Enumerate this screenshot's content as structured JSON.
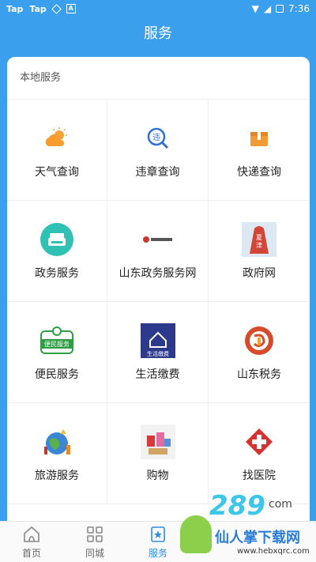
{
  "status": {
    "left_icons": [
      "Tap",
      "Tap"
    ],
    "time": "7:36"
  },
  "app_bar": {
    "title": "服务"
  },
  "section": {
    "title": "本地服务"
  },
  "services": [
    {
      "label": "天气查询",
      "icon": "weather-icon"
    },
    {
      "label": "违章查询",
      "icon": "traffic-violation-icon"
    },
    {
      "label": "快递查询",
      "icon": "package-icon"
    },
    {
      "label": "政务服务",
      "icon": "government-service-icon"
    },
    {
      "label": "山东政务服务网",
      "icon": "shandong-gov-logo"
    },
    {
      "label": "政府网",
      "icon": "government-site-icon"
    },
    {
      "label": "便民服务",
      "icon": "convenience-icon",
      "icon_text": "便民服务"
    },
    {
      "label": "生活缴费",
      "icon": "life-payment-icon",
      "icon_text": "生活缴费"
    },
    {
      "label": "山东税务",
      "icon": "tax-icon"
    },
    {
      "label": "旅游服务",
      "icon": "tourism-icon"
    },
    {
      "label": "购物",
      "icon": "shopping-icon"
    },
    {
      "label": "找医院",
      "icon": "hospital-icon"
    }
  ],
  "bottom_nav": [
    {
      "label": "首页",
      "icon": "home-icon"
    },
    {
      "label": "同城",
      "icon": "grid-icon"
    },
    {
      "label": "服务",
      "icon": "service-icon",
      "active": true
    },
    {
      "label": "",
      "icon": ""
    },
    {
      "label": "",
      "icon": ""
    }
  ],
  "watermark": {
    "brand": "289",
    "suffix": "com",
    "main": "仙人掌下载网",
    "url": "www.hebxqrc.com"
  },
  "colors": {
    "primary": "#3aa0ee",
    "active_nav": "#2f8ee6"
  }
}
